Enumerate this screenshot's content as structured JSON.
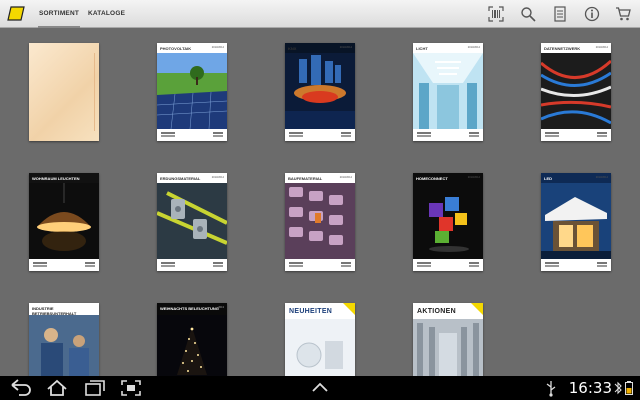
{
  "topbar": {
    "tabs": [
      {
        "label": "SORTIMENT",
        "selected": true
      },
      {
        "label": "KATALOGE",
        "selected": false
      }
    ],
    "icons": [
      "barcode-scan-icon",
      "search-icon",
      "list-icon",
      "info-icon",
      "cart-icon"
    ]
  },
  "catalogs": [
    {
      "title": "",
      "year": ""
    },
    {
      "title": "PHOTOVOLTAIK",
      "year": "2013/2014"
    },
    {
      "title": "KNX",
      "year": "2013/2014"
    },
    {
      "title": "LICHT",
      "year": "2013/2014"
    },
    {
      "title": "DATENNETZWERK",
      "year": "2013/2014"
    },
    {
      "title": "WOHNRAUM LEUCHTEN",
      "year": "2013/2014"
    },
    {
      "title": "ERDUNGSMATERIAL",
      "year": "2013/2014"
    },
    {
      "title": "BAUFEMATERIAL",
      "year": "2013/2014"
    },
    {
      "title": "HOMECONNECT",
      "year": "2013/2014"
    },
    {
      "title": "LED",
      "year": "2013/2014"
    },
    {
      "title": "INDUSTRIE BETRIEBSUNTERHALT",
      "year": "2013/2014"
    },
    {
      "title": "WEIHNACHTS BELEUCHTUNG",
      "year": "2013"
    },
    {
      "title": "NEUHEITEN",
      "year": ""
    },
    {
      "title": "AKTIONEN",
      "year": ""
    }
  ],
  "colors": {
    "brand_yellow": "#f4d800",
    "background": "#6b6b6b"
  },
  "statusbar": {
    "time": "16:33"
  }
}
